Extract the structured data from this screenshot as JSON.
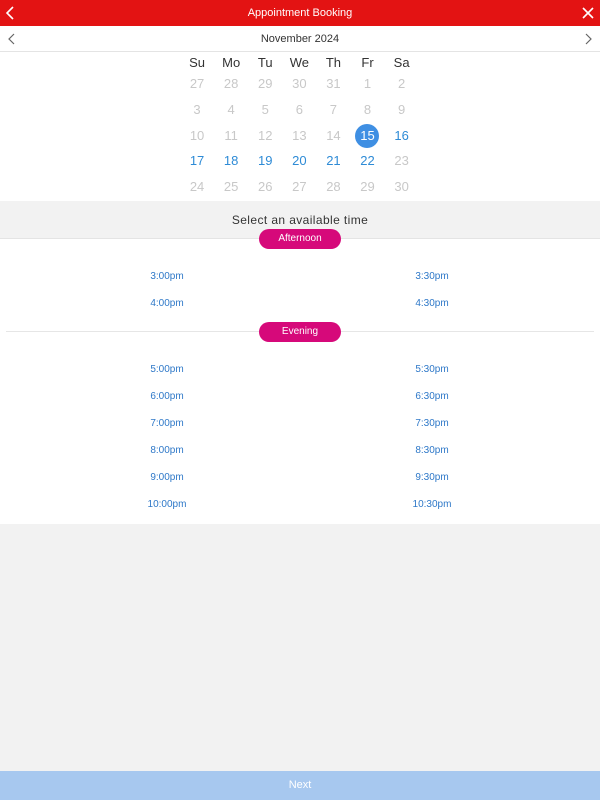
{
  "header": {
    "title": "Appointment Booking"
  },
  "calendar": {
    "month_label": "November 2024",
    "weekdays": [
      "Su",
      "Mo",
      "Tu",
      "We",
      "Th",
      "Fr",
      "Sa"
    ],
    "weeks": [
      [
        {
          "d": "27",
          "s": "disabled"
        },
        {
          "d": "28",
          "s": "disabled"
        },
        {
          "d": "29",
          "s": "disabled"
        },
        {
          "d": "30",
          "s": "disabled"
        },
        {
          "d": "31",
          "s": "disabled"
        },
        {
          "d": "1",
          "s": "disabled"
        },
        {
          "d": "2",
          "s": "disabled"
        }
      ],
      [
        {
          "d": "3",
          "s": "disabled"
        },
        {
          "d": "4",
          "s": "disabled"
        },
        {
          "d": "5",
          "s": "disabled"
        },
        {
          "d": "6",
          "s": "disabled"
        },
        {
          "d": "7",
          "s": "disabled"
        },
        {
          "d": "8",
          "s": "disabled"
        },
        {
          "d": "9",
          "s": "disabled"
        }
      ],
      [
        {
          "d": "10",
          "s": "disabled"
        },
        {
          "d": "11",
          "s": "disabled"
        },
        {
          "d": "12",
          "s": "disabled"
        },
        {
          "d": "13",
          "s": "disabled"
        },
        {
          "d": "14",
          "s": "disabled"
        },
        {
          "d": "15",
          "s": "selected"
        },
        {
          "d": "16",
          "s": "available"
        }
      ],
      [
        {
          "d": "17",
          "s": "available"
        },
        {
          "d": "18",
          "s": "available"
        },
        {
          "d": "19",
          "s": "available"
        },
        {
          "d": "20",
          "s": "available"
        },
        {
          "d": "21",
          "s": "available"
        },
        {
          "d": "22",
          "s": "available"
        },
        {
          "d": "23",
          "s": "disabled"
        }
      ],
      [
        {
          "d": "24",
          "s": "disabled"
        },
        {
          "d": "25",
          "s": "disabled"
        },
        {
          "d": "26",
          "s": "disabled"
        },
        {
          "d": "27",
          "s": "disabled"
        },
        {
          "d": "28",
          "s": "disabled"
        },
        {
          "d": "29",
          "s": "disabled"
        },
        {
          "d": "30",
          "s": "disabled"
        }
      ]
    ]
  },
  "prompt": "Select an available time",
  "sections": [
    {
      "name": "Afternoon",
      "slots": [
        [
          "3:00pm",
          "3:30pm"
        ],
        [
          "4:00pm",
          "4:30pm"
        ]
      ]
    },
    {
      "name": "Evening",
      "slots": [
        [
          "5:00pm",
          "5:30pm"
        ],
        [
          "6:00pm",
          "6:30pm"
        ],
        [
          "7:00pm",
          "7:30pm"
        ],
        [
          "8:00pm",
          "8:30pm"
        ],
        [
          "9:00pm",
          "9:30pm"
        ],
        [
          "10:00pm",
          "10:30pm"
        ]
      ]
    }
  ],
  "footer": {
    "next_label": "Next"
  },
  "colors": {
    "header_bg": "#e31313",
    "selected_day": "#3f8fe3",
    "available_day": "#2e8bd6",
    "pill_bg": "#d6097a",
    "slot_text": "#2e78c8",
    "next_bg": "#a7c8ef"
  },
  "icons": {
    "back": "chevron-left-icon",
    "close": "close-icon",
    "prev_month": "chevron-left-icon",
    "next_month": "chevron-right-icon"
  }
}
